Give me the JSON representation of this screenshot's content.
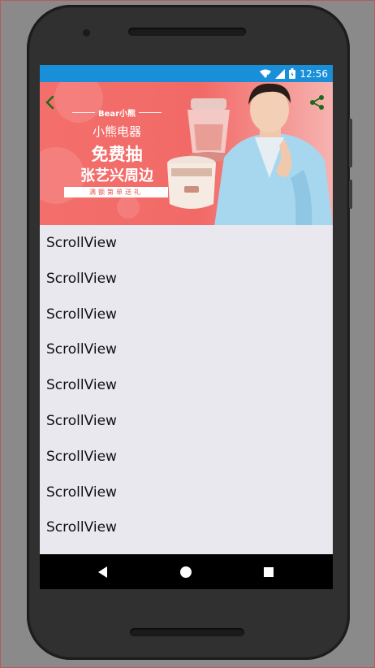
{
  "status_bar": {
    "time": "12:56",
    "icons": [
      "wifi-icon",
      "signal-icon",
      "battery-icon"
    ],
    "color": "#1a8fd9"
  },
  "banner": {
    "brand_logo": "Bear小熊",
    "brand_name": "小熊电器",
    "headline": "免费抽",
    "subline": "张艺兴周边",
    "tag": "满额第单送礼",
    "background": "#f36f6c",
    "back_icon": "back-arrow-icon",
    "share_icon": "share-icon"
  },
  "list": {
    "items": [
      "ScrollView",
      "ScrollView",
      "ScrollView",
      "ScrollView",
      "ScrollView",
      "ScrollView",
      "ScrollView",
      "ScrollView",
      "ScrollView"
    ]
  },
  "nav_bar": {
    "buttons": [
      "back-triangle-icon",
      "home-circle-icon",
      "recents-square-icon"
    ]
  }
}
